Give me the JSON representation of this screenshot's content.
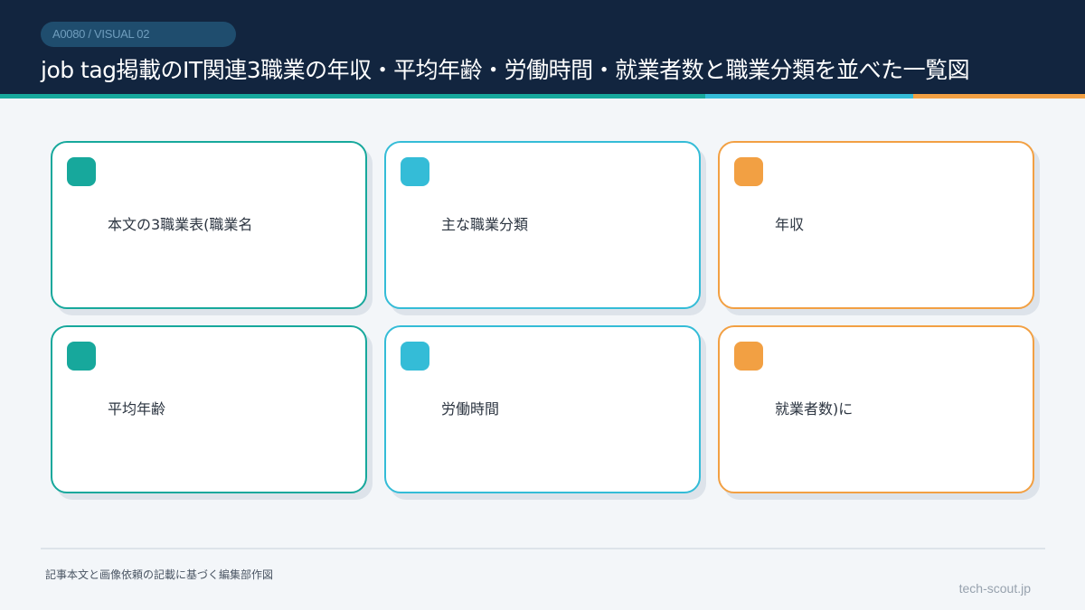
{
  "header": {
    "badge": "A0080 / VISUAL 02",
    "title": "job tag掲載のIT関連3職業の年収・平均年齢・労働時間・就業者数と職業分類を並べた一覧図"
  },
  "colors": {
    "header_bg": "#12253f",
    "teal": "#17a89c",
    "cyan": "#34bcd7",
    "orange": "#f2a043"
  },
  "cards": [
    {
      "label": "本文の3職業表(職業名",
      "color": "teal"
    },
    {
      "label": "主な職業分類",
      "color": "cyan"
    },
    {
      "label": "年収",
      "color": "orange"
    },
    {
      "label": "平均年齢",
      "color": "teal"
    },
    {
      "label": "労働時間",
      "color": "cyan"
    },
    {
      "label": "就業者数)に",
      "color": "orange"
    }
  ],
  "footer": {
    "note": "記事本文と画像依頼の記載に基づく編集部作図",
    "site": "tech-scout.jp"
  }
}
